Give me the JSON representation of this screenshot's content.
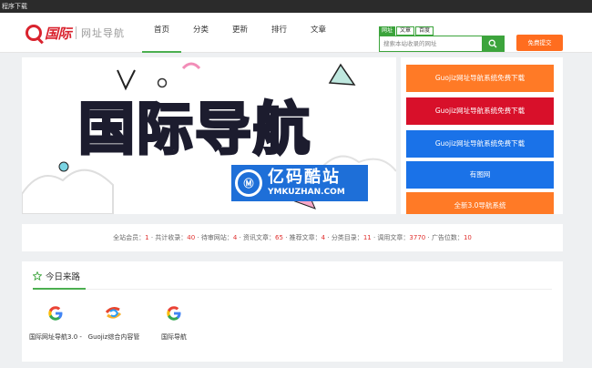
{
  "topbar": {
    "text": "程序下载"
  },
  "header": {
    "logo_main": "国际",
    "logo_sub": "网址导航",
    "nav": [
      "首页",
      "分类",
      "更新",
      "排行",
      "文章"
    ],
    "search_tabs": [
      "网址",
      "文章",
      "百度"
    ],
    "search_placeholder": "搜索本站收录的网址",
    "submit_label": "免费提交"
  },
  "banner": {
    "headline": "国际导航",
    "watermark_cn": "亿码酷站",
    "watermark_en": "YMKUZHAN.COM"
  },
  "side_links": [
    {
      "label": "Guojiz网址导航系统免费下载",
      "color": "#ff7a26"
    },
    {
      "label": "Guojiz网址导航系统免费下载",
      "color": "#d8102a"
    },
    {
      "label": "Guojiz网址导航系统免费下载",
      "color": "#1a72e8"
    },
    {
      "label": "有图网",
      "color": "#1a72e8"
    },
    {
      "label": "全新3.0导航系统",
      "color": "#ff7a26"
    }
  ],
  "stats": [
    {
      "label": "全站会员：",
      "value": "1"
    },
    {
      "label": "共计收录：",
      "value": "40"
    },
    {
      "label": "待审网站：",
      "value": "4"
    },
    {
      "label": "资讯文章：",
      "value": "65"
    },
    {
      "label": "推荐文章：",
      "value": "4"
    },
    {
      "label": "分类目录：",
      "value": "11"
    },
    {
      "label": "调用文章：",
      "value": "3770"
    },
    {
      "label": "广告位数：",
      "value": "10"
    }
  ],
  "today": {
    "title": "今日来路",
    "sources": [
      {
        "label": "国际网址导航3.0 -",
        "icon": "google-icon"
      },
      {
        "label": "Guojiz综合内容管",
        "icon": "swirl-logo-icon"
      },
      {
        "label": "国际导航",
        "icon": "google-icon"
      }
    ]
  }
}
